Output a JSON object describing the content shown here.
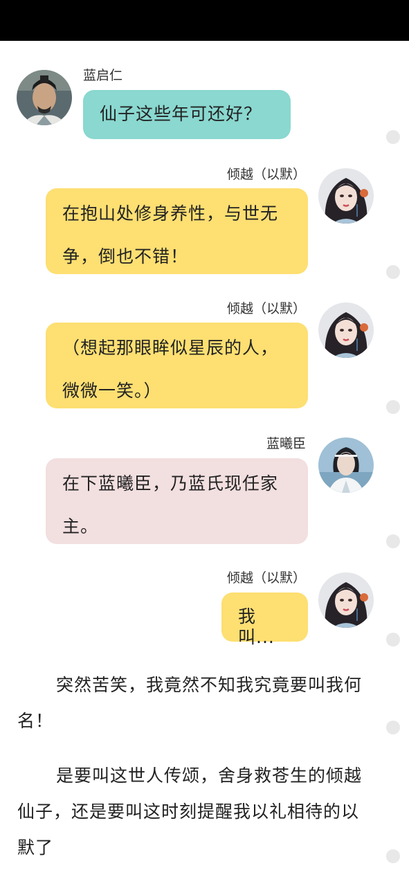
{
  "messages": [
    {
      "speaker": "蓝启仁",
      "text": "仙子这些年可还好？",
      "bubble_color": "#8ad8d0",
      "side": "left",
      "avatar": "avatar-lan-qiren"
    },
    {
      "speaker": "倾越（以默）",
      "text": "在抱山处修身养性，与世无争，倒也不错！",
      "bubble_color": "#fddf72",
      "side": "right",
      "avatar": "avatar-qingyue"
    },
    {
      "speaker": "倾越（以默）",
      "text": "（想起那眼眸似星辰的人，微微一笑。）",
      "bubble_color": "#fddf72",
      "side": "right",
      "avatar": "avatar-qingyue"
    },
    {
      "speaker": "蓝曦臣",
      "text": "在下蓝曦臣，乃蓝氏现任家主。",
      "bubble_color": "#f2dfe0",
      "side": "right",
      "avatar": "avatar-lan-xichen"
    },
    {
      "speaker": "倾越（以默）",
      "text": "我叫...",
      "bubble_color": "#fddf72",
      "side": "right",
      "avatar": "avatar-qingyue"
    }
  ],
  "narration": [
    "突然苦笑，我竟然不知我究竟要叫我何名！",
    "是要叫这世人传颂，舍身救苍生的倾越仙子，还是要叫这时刻提醒我以礼相待的以默了"
  ]
}
